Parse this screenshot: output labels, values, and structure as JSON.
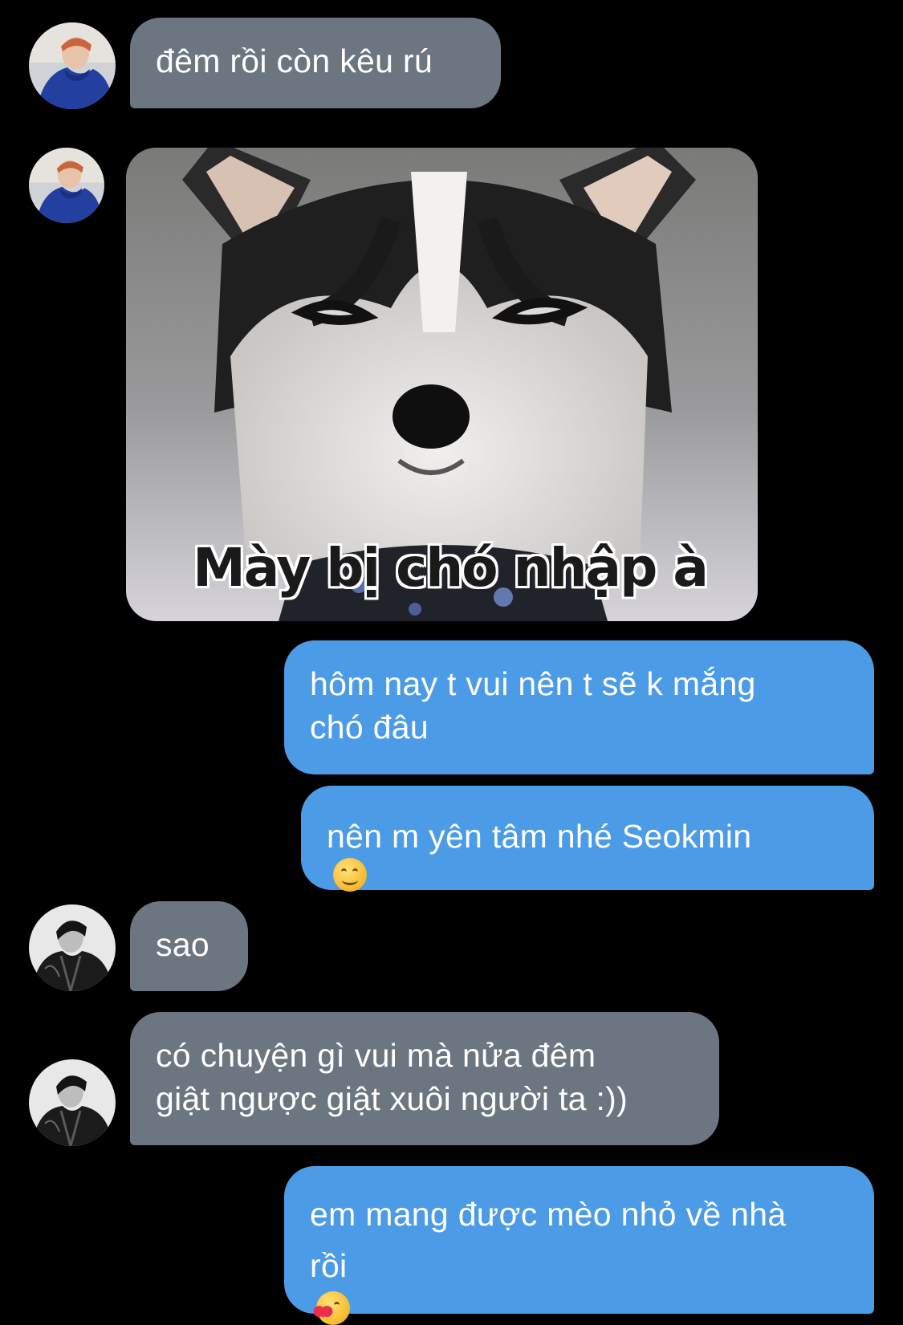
{
  "messages": [
    {
      "id": "m1",
      "side": "in",
      "text_lines": [
        "đêm rồi còn kêu rú"
      ]
    },
    {
      "id": "m2",
      "side": "in",
      "type": "image",
      "caption": "Mày bị chó nhập à"
    },
    {
      "id": "m3",
      "side": "out",
      "text_lines": [
        "hôm nay t vui nên t sẽ k mắng",
        "chó đâu"
      ]
    },
    {
      "id": "m4",
      "side": "out",
      "text_lines": [
        "nên m yên tâm nhé Seokmin"
      ],
      "emoji": "smiling-face-emoji"
    },
    {
      "id": "m5",
      "side": "in",
      "text_lines": [
        "sao"
      ]
    },
    {
      "id": "m6",
      "side": "in",
      "text_lines": [
        "có chuyện gì vui mà nửa đêm",
        "giật ngược giật xuôi người ta :))"
      ]
    },
    {
      "id": "m7",
      "side": "out",
      "text_lines": [
        "em mang được mèo nhỏ về nhà",
        "rồi"
      ],
      "emoji": "smiling-face-with-hearts-emoji"
    }
  ],
  "colors": {
    "background": "#000000",
    "incoming_bubble": "#6b7681",
    "outgoing_bubble": "#4c9be6",
    "text": "#ffffff"
  }
}
